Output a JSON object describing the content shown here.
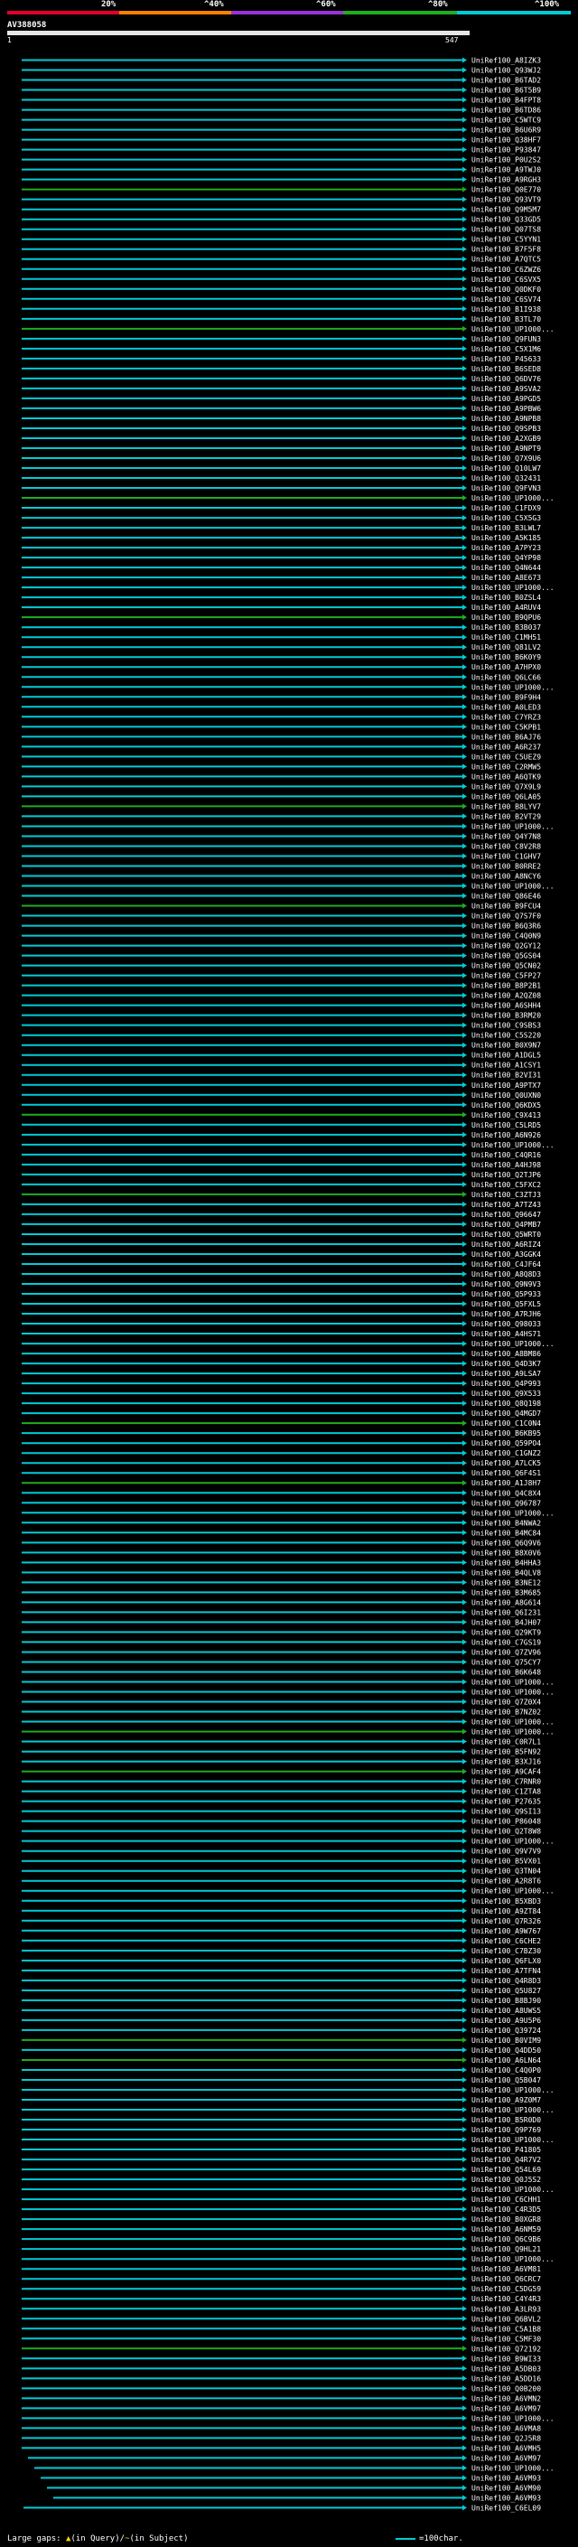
{
  "legend": {
    "labels": [
      "20%",
      "^40%",
      "^60%",
      "^80%",
      "^100%"
    ],
    "colors": [
      "#e4002b",
      "#ff8000",
      "#9b30d9",
      "#1fad1f",
      "#00ccd6"
    ]
  },
  "query": {
    "name": "AV388058",
    "start": "1",
    "end": "547"
  },
  "footer": {
    "large_gaps_label": "Large gaps:",
    "in_query": "(in Query)/",
    "in_subject": "(in Subject)",
    "scale_label": "=100char."
  },
  "hits": [
    "UniRef100_A8IZK3",
    "UniRef100_Q93WJ2",
    "UniRef100_B6TAD2",
    "UniRef100_B6T5B9",
    "UniRef100_B4FPT8",
    "UniRef100_B6TD86",
    "UniRef100_C5WTC9",
    "UniRef100_B6U6R9",
    "UniRef100_Q38HF7",
    "UniRef100_P93847",
    "UniRef100_P0U2S2",
    "UniRef100_A9TWJ0",
    "UniRef100_A9RGH3",
    "UniRef100_Q0E770",
    "UniRef100_Q93VT9",
    "UniRef100_Q9M5M7",
    "UniRef100_Q33GD5",
    "UniRef100_Q07TS8",
    "UniRef100_C5YYN1",
    "UniRef100_B7F5F8",
    "UniRef100_A7QTC5",
    "UniRef100_C6ZWZ6",
    "UniRef100_C6SVX5",
    "UniRef100_Q0DKF0",
    "UniRef100_C6SV74",
    "UniRef100_B1I938",
    "UniRef100_B3TL70",
    "UniRef100_UP1000...",
    "UniRef100_Q9FUN3",
    "UniRef100_C5X1M6",
    "UniRef100_P45633",
    "UniRef100_B6SED8",
    "UniRef100_Q6DV76",
    "UniRef100_A9SVA2",
    "UniRef100_A9PGD5",
    "UniRef100_A9PBW6",
    "UniRef100_A9NPB8",
    "UniRef100_Q9SPB3",
    "UniRef100_A2XGB9",
    "UniRef100_A9NPT9",
    "UniRef100_Q7X9U6",
    "UniRef100_Q10LW7",
    "UniRef100_Q32431",
    "UniRef100_Q9FVN3",
    "UniRef100_UP1000...",
    "UniRef100_C1FDX9",
    "UniRef100_C5X5G3",
    "UniRef100_B3LWL7",
    "UniRef100_A5K185",
    "UniRef100_A7PY23",
    "UniRef100_Q4YP98",
    "UniRef100_Q4N644",
    "UniRef100_A8E673",
    "UniRef100_UP1000...",
    "UniRef100_B0ZSL4",
    "UniRef100_A4RUV4",
    "UniRef100_B9QPU6",
    "UniRef100_B3B037",
    "UniRef100_C1MH51",
    "UniRef100_Q81LV2",
    "UniRef100_B6K0Y9",
    "UniRef100_A7HPX0",
    "UniRef100_Q6LC66",
    "UniRef100_UP1000...",
    "UniRef100_B9F9H4",
    "UniRef100_A0LED3",
    "UniRef100_C7YRZ3",
    "UniRef100_C5KPB1",
    "UniRef100_B6AJ76",
    "UniRef100_A6R237",
    "UniRef100_C5UEZ9",
    "UniRef100_C2RMW5",
    "UniRef100_A6QTK9",
    "UniRef100_Q7X9L9",
    "UniRef100_Q6LA05",
    "UniRef100_B8LYV7",
    "UniRef100_B2VT29",
    "UniRef100_UP1000...",
    "UniRef100_Q4Y7N8",
    "UniRef100_C8V2R8",
    "UniRef100_C1GHV7",
    "UniRef100_B0RRE2",
    "UniRef100_A8NCY6",
    "UniRef100_UP1000...",
    "UniRef100_Q86E46",
    "UniRef100_B9FCU4",
    "UniRef100_Q7S7F0",
    "UniRef100_B6Q3R6",
    "UniRef100_C4Q0N9",
    "UniRef100_Q2GY12",
    "UniRef100_Q5GS04",
    "UniRef100_Q5CN02",
    "UniRef100_C5FP27",
    "UniRef100_B8P2B1",
    "UniRef100_A2QZ08",
    "UniRef100_A6SHH4",
    "UniRef100_B3RM20",
    "UniRef100_C9SBS3",
    "UniRef100_C5S220",
    "UniRef100_B0X9N7",
    "UniRef100_A1DGL5",
    "UniRef100_A1CSY1",
    "UniRef100_B2VI31",
    "UniRef100_A9PTX7",
    "UniRef100_Q0UXN0",
    "UniRef100_Q6KDX5",
    "UniRef100_C9X413",
    "UniRef100_C5LRD5",
    "UniRef100_A6N926",
    "UniRef100_UP1000...",
    "UniRef100_C4QR16",
    "UniRef100_A4HJ98",
    "UniRef100_Q2TJP6",
    "UniRef100_C5FXC2",
    "UniRef100_C3ZTJ3",
    "UniRef100_A7TZ43",
    "UniRef100_Q96647",
    "UniRef100_Q4PMB7",
    "UniRef100_Q5WRT0",
    "UniRef100_A6RIZ4",
    "UniRef100_A3GGK4",
    "UniRef100_C4JF64",
    "UniRef100_A8Q8D3",
    "UniRef100_Q9N9V3",
    "UniRef100_Q5P933",
    "UniRef100_Q5FXL5",
    "UniRef100_A7RJH6",
    "UniRef100_Q98033",
    "UniRef100_A4HS71",
    "UniRef100_UP1000...",
    "UniRef100_A8BM86",
    "UniRef100_Q4D3K7",
    "UniRef100_A9LSA7",
    "UniRef100_Q4P993",
    "UniRef100_Q9X533",
    "UniRef100_Q8Q198",
    "UniRef100_Q4MGD7",
    "UniRef100_C1C0N4",
    "UniRef100_B6KB95",
    "UniRef100_Q59PO4",
    "UniRef100_C1GNZ2",
    "UniRef100_A7LCK5",
    "UniRef100_Q6F4S1",
    "UniRef100_A1J8H7",
    "UniRef100_Q4C8X4",
    "UniRef100_Q96787",
    "UniRef100_UP1000...",
    "UniRef100_B4NWA2",
    "UniRef100_B4MC84",
    "UniRef100_Q6Q9V6",
    "UniRef100_B8X0V6",
    "UniRef100_B4HHA3",
    "UniRef100_B4QLV8",
    "UniRef100_B3NE12",
    "UniRef100_B3M685",
    "UniRef100_A8G614",
    "UniRef100_Q6I231",
    "UniRef100_B4JH07",
    "UniRef100_Q29KT9",
    "UniRef100_C7GS19",
    "UniRef100_Q7ZV96",
    "UniRef100_Q75CY7",
    "UniRef100_B6K648",
    "UniRef100_UP1000...",
    "UniRef100_UP1000...",
    "UniRef100_Q7Z0X4",
    "UniRef100_B7NZ02",
    "UniRef100_UP1000...",
    "UniRef100_UP1000...",
    "UniRef100_C0R7L1",
    "UniRef100_B5FN92",
    "UniRef100_B3XJ16",
    "UniRef100_A9CAF4",
    "UniRef100_C7RNR0",
    "UniRef100_C1ZTA8",
    "UniRef100_P27635",
    "UniRef100_Q9SI13",
    "UniRef100_P86048",
    "UniRef100_Q2T8W8",
    "UniRef100_UP1000...",
    "UniRef100_Q9V7V9",
    "UniRef100_B5VX01",
    "UniRef100_Q3TN04",
    "UniRef100_A2R8T6",
    "UniRef100_UP1000...",
    "UniRef100_B5XBD3",
    "UniRef100_A9ZT84",
    "UniRef100_Q7R326",
    "UniRef100_A9W767",
    "UniRef100_C6CHE2",
    "UniRef100_C7BZ30",
    "UniRef100_Q6FLX0",
    "UniRef100_A7TFN4",
    "UniRef100_Q4R8D3",
    "UniRef100_Q5U827",
    "UniRef100_B8BJ90",
    "UniRef100_A8UWS5",
    "UniRef100_A9U5P6",
    "UniRef100_Q39724",
    "UniRef100_B0VIM9",
    "UniRef100_Q4DD50",
    "UniRef100_A6LN64",
    "UniRef100_C4Q0P0",
    "UniRef100_Q5B047",
    "UniRef100_UP1000...",
    "UniRef100_A9Z0M7",
    "UniRef100_UP1000...",
    "UniRef100_B5R0D0",
    "UniRef100_Q9P769",
    "UniRef100_UP1000...",
    "UniRef100_P41805",
    "UniRef100_Q4R7V2",
    "UniRef100_Q54L69",
    "UniRef100_Q0J5S2",
    "UniRef100_UP1000...",
    "UniRef100_C6CHH1",
    "UniRef100_C4R3D5",
    "UniRef100_B0XGR8",
    "UniRef100_A6NM59",
    "UniRef100_Q6C9B6",
    "UniRef100_Q9HL21",
    "UniRef100_UP1000...",
    "UniRef100_A6VM81",
    "UniRef100_Q6CRC7",
    "UniRef100_C5DG59",
    "UniRef100_C4Y4R3",
    "UniRef100_A3LR93",
    "UniRef100_Q6BVL2",
    "UniRef100_C5A1B8",
    "UniRef100_C5MF30",
    "UniRef100_Q72192",
    "UniRef100_B9WI33",
    "UniRef100_A5DB03",
    "UniRef100_A5DD16",
    "UniRef100_Q0B200",
    "UniRef100_A6VMN2",
    "UniRef100_A6VM97",
    "UniRef100_UP1000...",
    "UniRef100_A6VMA8",
    "UniRef100_Q2J5R8",
    "UniRef100_A6VMH5",
    "UniRef100_A6VM97",
    "UniRef100_UP1000...",
    "UniRef100_A6VM93",
    "UniRef100_A6VM90",
    "UniRef100_A6VM93",
    "UniRef100_C6EL09"
  ]
}
